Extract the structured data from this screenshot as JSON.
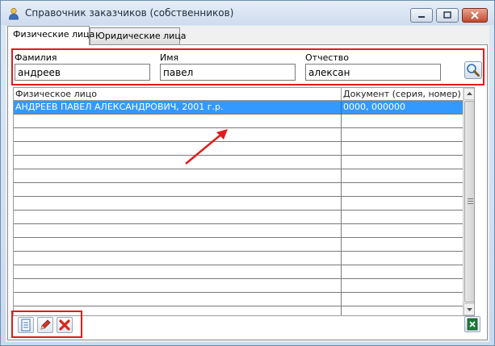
{
  "window": {
    "title": "Справочник заказчиков (собственников)"
  },
  "tabs": [
    {
      "label": "Физические лица",
      "active": true
    },
    {
      "label": "Юридические лица",
      "active": false
    }
  ],
  "search": {
    "surname_label": "Фамилия",
    "surname_value": "андреев",
    "name_label": "Имя",
    "name_value": "павел",
    "patronymic_label": "Отчество",
    "patronymic_value": "алексан"
  },
  "grid": {
    "columns": [
      "Физическое лицо",
      "Документ (серия, номер)"
    ],
    "rows": [
      {
        "person": "АНДРЕЕВ ПАВЕЛ АЛЕКСАНДРОВИЧ, 2001 г.р.",
        "document": "0000, 000000",
        "selected": true
      }
    ],
    "empty_row_count": 15
  },
  "toolbar": {
    "buttons": [
      "new-document-icon",
      "pencil-icon",
      "delete-x-icon"
    ],
    "export_icon": "excel-icon"
  },
  "colors": {
    "selection": "#3399ff",
    "annotation": "#e01b1b"
  }
}
